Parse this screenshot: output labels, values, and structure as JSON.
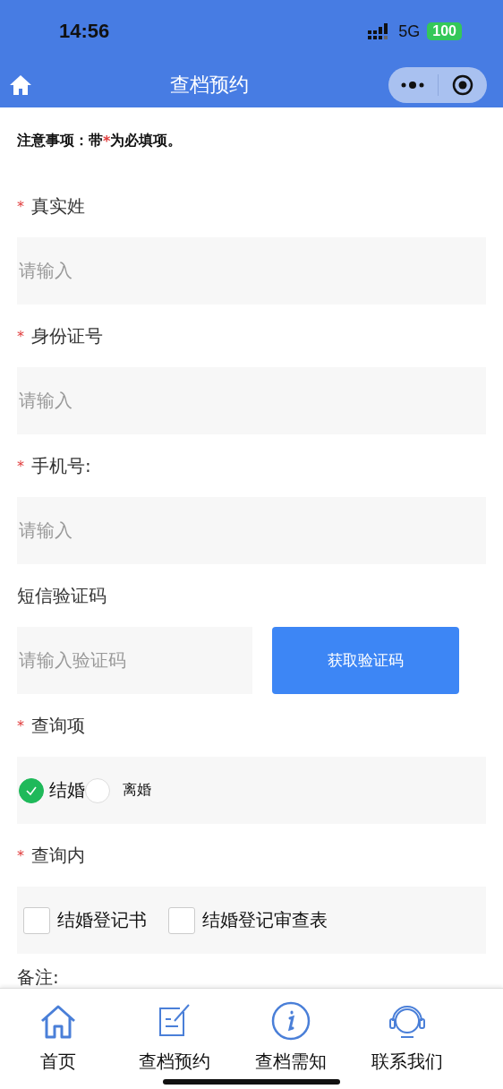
{
  "status_bar": {
    "time": "14:56",
    "network": "5G",
    "battery": "100"
  },
  "nav_bar": {
    "title": "查档预约"
  },
  "notice": {
    "prefix": "注意事项：带",
    "mark": "*",
    "suffix": "为必填项。"
  },
  "fields": [
    {
      "kind": "text",
      "mark": "*",
      "label": "真实姓",
      "placeholder": "请输入"
    },
    {
      "kind": "text",
      "mark": "*",
      "label": "身份证号",
      "placeholder": "请输入"
    },
    {
      "kind": "text",
      "mark": "*",
      "label": "手机号:",
      "placeholder": "请输入"
    },
    {
      "kind": "code",
      "label": "短信验证码",
      "placeholder": "请输入验证码",
      "button": "获取验证码"
    },
    {
      "kind": "radio",
      "mark": "*",
      "label": "查询项",
      "options": [
        {
          "label": "结婚",
          "selected": true
        },
        {
          "label": "离婚",
          "selected": false
        }
      ]
    },
    {
      "kind": "checkbox",
      "mark": "*",
      "label": "查询内",
      "options": [
        {
          "label": "结婚登记书",
          "checked": false
        },
        {
          "label": "结婚登记审查表",
          "checked": false
        }
      ]
    },
    {
      "kind": "label",
      "label": "备注:"
    }
  ],
  "tab_bar": [
    {
      "label": "首页"
    },
    {
      "label": "查档预约"
    },
    {
      "label": "查档需知"
    },
    {
      "label": "联系我们"
    }
  ]
}
